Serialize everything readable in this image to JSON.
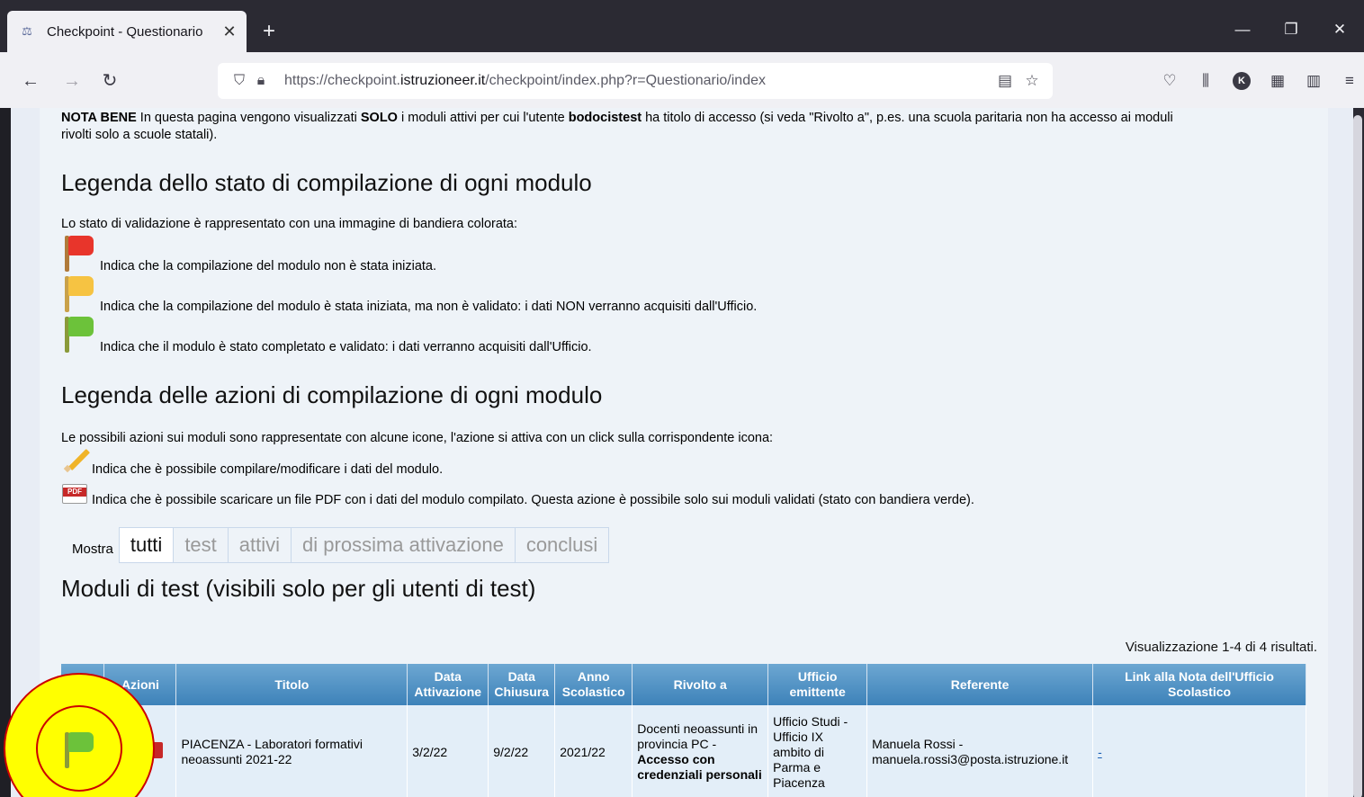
{
  "browser": {
    "tab_title": "Checkpoint - Questionario",
    "tab_close": "✕",
    "new_tab": "+",
    "url_prefix": "https://checkpoint.",
    "url_domain": "istruzioneer.it",
    "url_path": "/checkpoint/index.php?r=Questionario/index",
    "avatar_letter": "K",
    "min": "—",
    "max": "❐",
    "close": "✕"
  },
  "notice": {
    "line1_a": "NOTA BENE",
    "line1_b": " In questa pagina vengono visualizzati ",
    "line1_c": "SOLO",
    "line1_d": " i moduli attivi per cui l'utente ",
    "line1_e": "bodocistest",
    "line1_f": " ha titolo di accesso (si veda \"Rivolto a\", p.es. una scuola paritaria non ha accesso ai moduli",
    "line2": "rivolti solo a scuole statali)."
  },
  "legend_status": {
    "heading": "Legenda dello stato di compilazione di ogni modulo",
    "intro": "Lo stato di validazione è rappresentato con una immagine di bandiera colorata:",
    "items": [
      {
        "text": "Indica che la compilazione del modulo non è stata iniziata.",
        "color": "#e8352b"
      },
      {
        "text": "Indica che la compilazione del modulo è stata iniziata, ma non è validato: i dati NON verranno acquisiti dall'Ufficio.",
        "color": "#f6c342"
      },
      {
        "text": "Indica che il modulo è stato completato e validato: i dati verranno acquisiti dall'Ufficio.",
        "color": "#6cc23a"
      }
    ]
  },
  "legend_actions": {
    "heading": "Legenda delle azioni di compilazione di ogni modulo",
    "intro": "Le possibili azioni sui moduli sono rappresentate con alcune icone, l'azione si attiva con un click sulla corrispondente icona:",
    "edit": "Indica che è possibile compilare/modificare i dati del modulo.",
    "pdf": "Indica che è possibile scaricare un file PDF con i dati del modulo compilato. Questa azione è possibile solo sui moduli validati (stato con bandiera verde).",
    "pdf_badge": "PDF"
  },
  "filter": {
    "label": "Mostra",
    "options": [
      "tutti",
      "test",
      "attivi",
      "di prossima attivazione",
      "conclusi"
    ]
  },
  "section_title": "Moduli di test (visibili solo per gli utenti di test)",
  "summary": "Visualizzazione 1-4 di 4 risultati.",
  "table": {
    "headers": [
      "",
      "Azioni",
      "Titolo",
      "Data Attivazione",
      "Data Chiusura",
      "Anno Scolastico",
      "Rivolto a",
      "Ufficio emittente",
      "Referente",
      "Link alla Nota dell'Ufficio Scolastico"
    ],
    "row1": {
      "titolo": "PIACENZA - Laboratori formativi neoassunti 2021-22",
      "attivazione": "3/2/22",
      "chiusura": "9/2/22",
      "anno": "2021/22",
      "rivolto_a": "Docenti neoassunti in provincia PC -",
      "rivolto_b": "Accesso con credenziali personali",
      "ufficio": "Ufficio Studi - Ufficio IX ambito di Parma e Piacenza",
      "referente": "Manuela Rossi - manuela.rossi3@posta.istruzione.it",
      "link": "-"
    }
  }
}
